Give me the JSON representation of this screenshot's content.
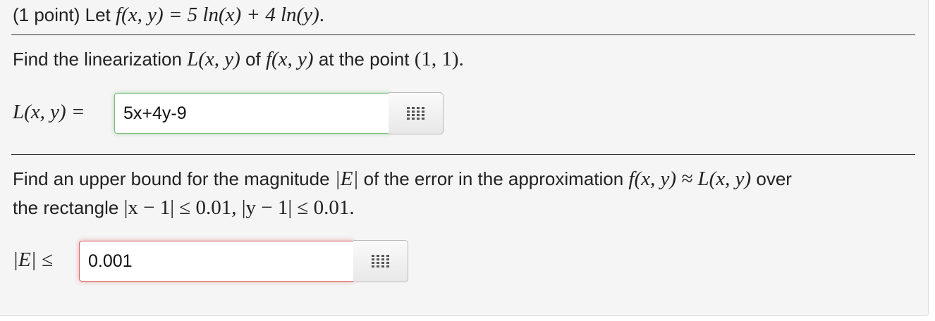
{
  "header": {
    "intro_text": "(1 point) Let ",
    "function_def": "f(x, y) = 5 ln(x) + 4 ln(y)",
    "end": "."
  },
  "part1": {
    "prompt_a": "Find the linearization ",
    "lin_name": "L(x, y)",
    "prompt_b": " of ",
    "func_name": "f(x, y)",
    "prompt_c": " at the point ",
    "point": "(1, 1)",
    "end": ".",
    "answer_label": "L(x, y) =",
    "answer_value": "5x+4y-9",
    "answer_status": "correct",
    "palette_icon": "equation-palette-icon"
  },
  "part2": {
    "prompt_a": "Find an upper bound for the magnitude ",
    "err_sym": "|E|",
    "prompt_b": " of the error in the approximation ",
    "approx": "f(x, y) ≈ L(x, y)",
    "prompt_c": " over",
    "prompt_d": "the rectangle ",
    "rect_cond": "|x − 1| ≤ 0.01,  |y − 1| ≤ 0.01",
    "end": ".",
    "answer_label": "|E| ≤",
    "answer_value": "0.001",
    "answer_status": "incorrect",
    "palette_icon": "equation-palette-icon"
  },
  "colors": {
    "correct_border": "#7bbf7f",
    "incorrect_border": "#d96767",
    "panel_bg": "#f5f5f5"
  }
}
